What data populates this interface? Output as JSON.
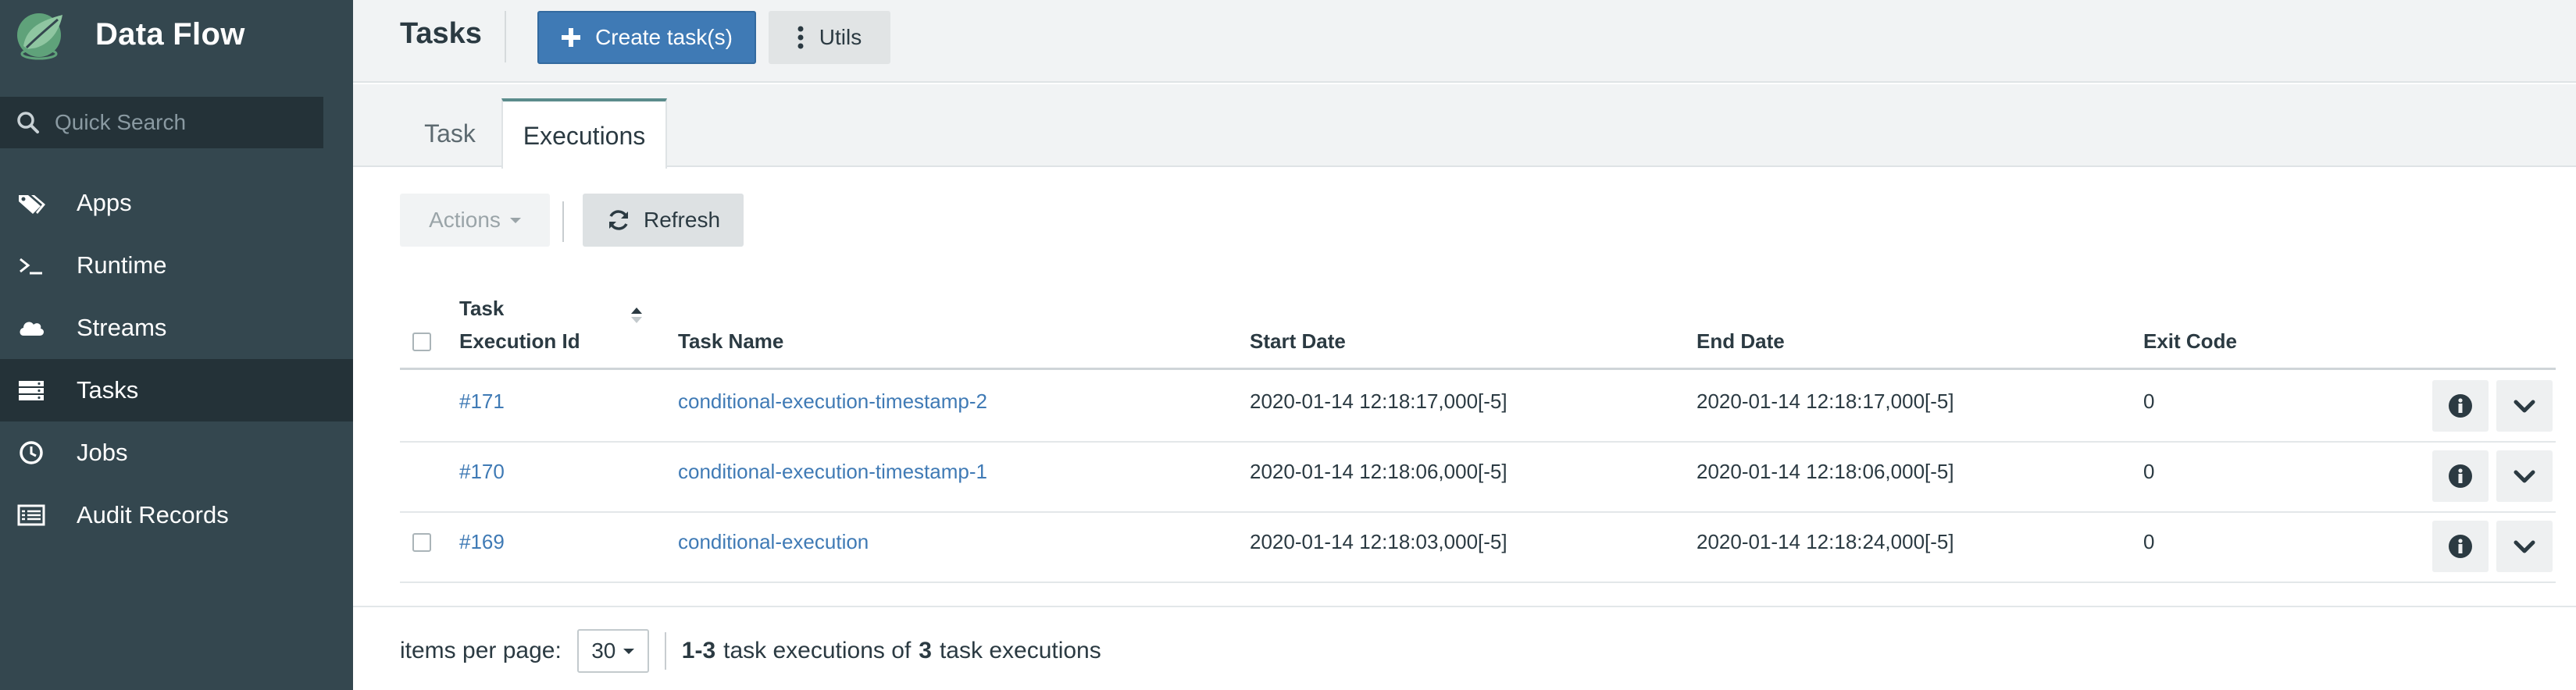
{
  "app": {
    "title": "Data Flow",
    "brand_color": "#34474f",
    "accent_color": "#3f7ab5"
  },
  "search": {
    "placeholder": "Quick Search",
    "icon": "search-icon"
  },
  "sidebar": {
    "items": [
      {
        "label": "Apps",
        "icon": "tags-icon",
        "active": false
      },
      {
        "label": "Runtime",
        "icon": "terminal-icon",
        "active": false
      },
      {
        "label": "Streams",
        "icon": "cloud-icon",
        "active": false
      },
      {
        "label": "Tasks",
        "icon": "server-icon",
        "active": true
      },
      {
        "label": "Jobs",
        "icon": "clock-icon",
        "active": false
      },
      {
        "label": "Audit Records",
        "icon": "list-icon",
        "active": false
      }
    ]
  },
  "header": {
    "title": "Tasks",
    "create_label": "Create task(s)",
    "utils_label": "Utils"
  },
  "tabs": [
    {
      "label": "Task",
      "active": false
    },
    {
      "label": "Executions",
      "active": true
    }
  ],
  "toolbar": {
    "actions_label": "Actions",
    "refresh_label": "Refresh"
  },
  "table": {
    "columns": {
      "execution_id_line1": "Task",
      "execution_id_line2": "Execution Id",
      "task_name": "Task Name",
      "start_date": "Start Date",
      "end_date": "End Date",
      "exit_code": "Exit Code"
    },
    "rows": [
      {
        "id": "#171",
        "task_name": "conditional-execution-timestamp-2",
        "start_date": "2020-01-14 12:18:17,000[-5]",
        "end_date": "2020-01-14 12:18:17,000[-5]",
        "exit_code": "0",
        "has_checkbox": false
      },
      {
        "id": "#170",
        "task_name": "conditional-execution-timestamp-1",
        "start_date": "2020-01-14 12:18:06,000[-5]",
        "end_date": "2020-01-14 12:18:06,000[-5]",
        "exit_code": "0",
        "has_checkbox": false
      },
      {
        "id": "#169",
        "task_name": "conditional-execution",
        "start_date": "2020-01-14 12:18:03,000[-5]",
        "end_date": "2020-01-14 12:18:24,000[-5]",
        "exit_code": "0",
        "has_checkbox": true
      }
    ]
  },
  "pagination": {
    "items_per_page_label": "items per page:",
    "page_size": "30",
    "range": "1-3",
    "text_mid": "task executions of",
    "total": "3",
    "text_end": "task executions"
  }
}
